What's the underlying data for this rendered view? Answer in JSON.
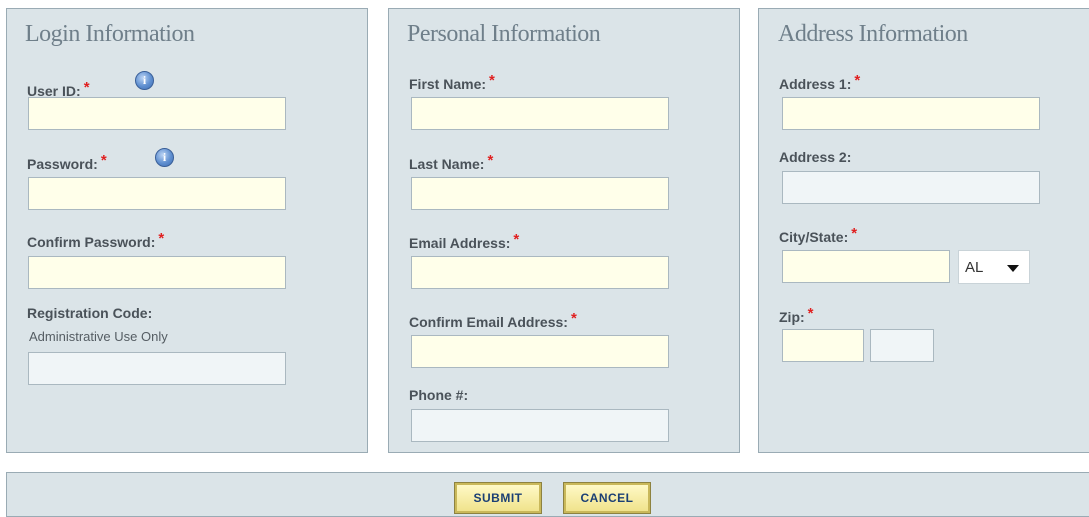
{
  "login": {
    "title": "Login Information",
    "user_id_label": "User ID:",
    "password_label": "Password:",
    "confirm_password_label": "Confirm Password:",
    "registration_code_label": "Registration Code:",
    "registration_code_note": "Administrative Use Only"
  },
  "personal": {
    "title": "Personal Information",
    "first_name_label": "First Name:",
    "last_name_label": "Last Name:",
    "email_label": "Email Address:",
    "confirm_email_label": "Confirm Email Address:",
    "phone_label": "Phone #:"
  },
  "address": {
    "title": "Address Information",
    "address1_label": "Address 1:",
    "address2_label": "Address 2:",
    "city_state_label": "City/State:",
    "state_value": "AL",
    "zip_label": "Zip:"
  },
  "common": {
    "required_mark": "*",
    "info_glyph": "i"
  },
  "buttons": {
    "submit": "SUBMIT",
    "cancel": "CANCEL"
  },
  "icons": {
    "info": "info-icon",
    "dropdown": "chevron-down-icon"
  },
  "colors": {
    "panel_bg": "#dbe4e8",
    "required": "#e02020",
    "field_bg": "#ffffea",
    "button_text": "#1b3f74"
  }
}
